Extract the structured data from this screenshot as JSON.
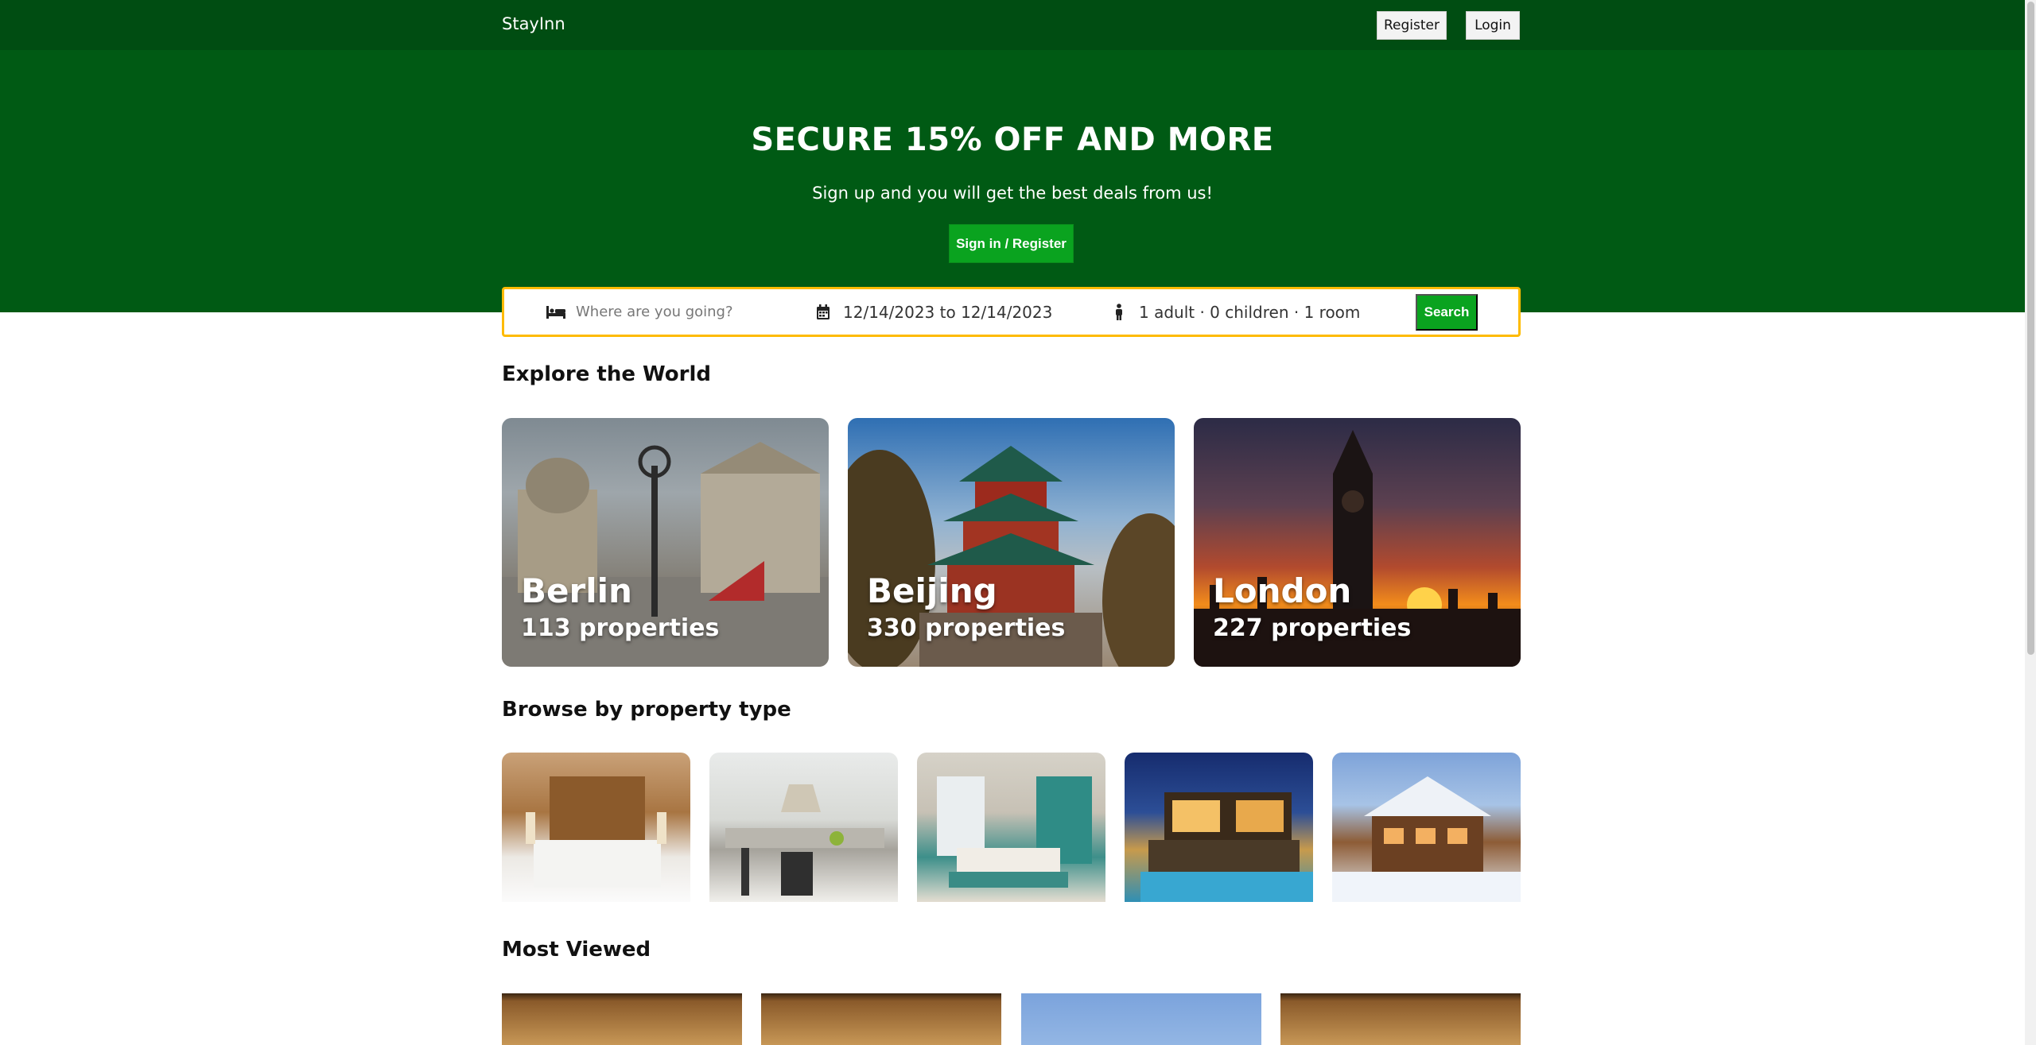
{
  "header": {
    "brand": "StayInn",
    "register_label": "Register",
    "login_label": "Login"
  },
  "hero": {
    "title": "SECURE 15% OFF AND MORE",
    "subtitle": "Sign up and you will get the best deals from us!",
    "cta_label": "Sign in / Register"
  },
  "search": {
    "location_placeholder": "Where are you going?",
    "dates": "12/14/2023 to 12/14/2023",
    "guests": "1 adult · 0 children · 1 room",
    "button_label": "Search"
  },
  "explore": {
    "title": "Explore the World",
    "cities": [
      {
        "name": "Berlin",
        "count": "113 properties"
      },
      {
        "name": "Beijing",
        "count": "330 properties"
      },
      {
        "name": "London",
        "count": "227 properties"
      }
    ]
  },
  "property_types": {
    "title": "Browse by property type",
    "items": [
      "hotel-bedroom",
      "apartment-kitchen",
      "resort-room",
      "villa-pool",
      "chalet-snow"
    ]
  },
  "most_viewed": {
    "title": "Most Viewed"
  },
  "icons": {
    "bed": "bed-icon",
    "calendar": "calendar-icon",
    "person": "person-icon"
  },
  "colors": {
    "nav": "#004d12",
    "hero": "#005a14",
    "accent": "#0aa31f",
    "search_border": "#febb02"
  }
}
